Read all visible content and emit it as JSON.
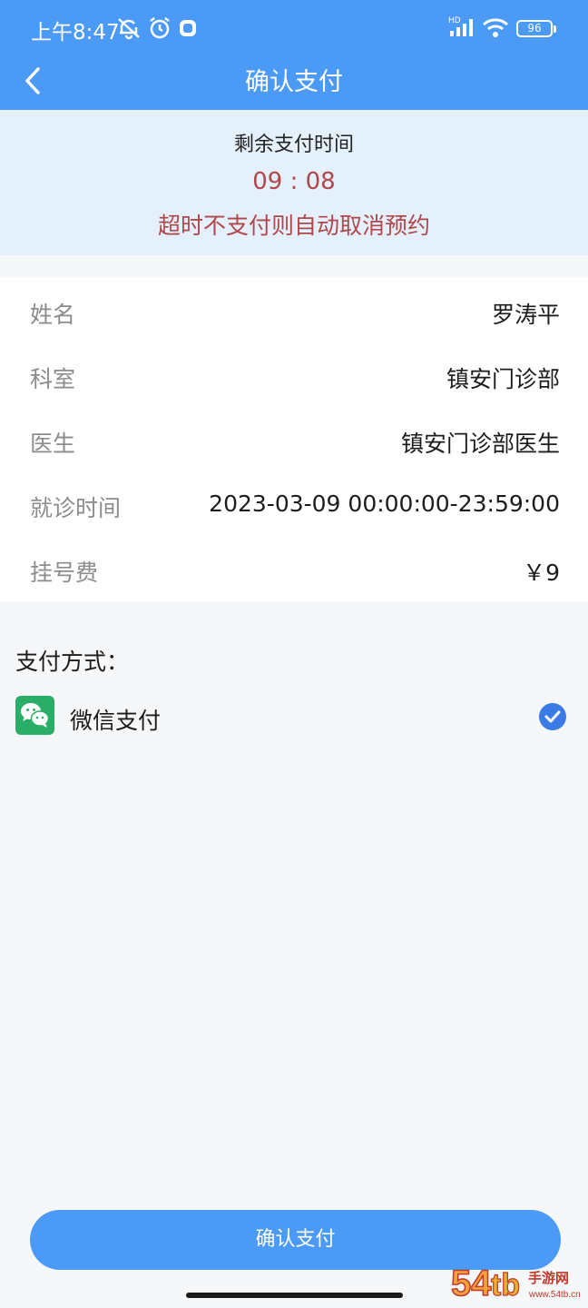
{
  "status_bar": {
    "time": "上午8:47",
    "network_type": "HD",
    "battery": "96",
    "icons": [
      "mute-icon",
      "alarm-icon",
      "app-notification-icon",
      "signal-icon",
      "wifi-icon",
      "battery-icon"
    ]
  },
  "navbar": {
    "title": "确认支付",
    "back_icon": "chevron-left-icon"
  },
  "countdown": {
    "label": "剩余支付时间",
    "value": "09 : 08",
    "warning": "超时不支付则自动取消预约"
  },
  "appointment": {
    "rows": [
      {
        "label": "姓名",
        "value": "罗涛平"
      },
      {
        "label": "科室",
        "value": "镇安门诊部"
      },
      {
        "label": "医生",
        "value": "镇安门诊部医生"
      },
      {
        "label": "就诊时间",
        "value": "2023-03-09 00:00:00-23:59:00"
      },
      {
        "label": "挂号费",
        "value": "￥9"
      }
    ]
  },
  "payment": {
    "title": "支付方式：",
    "method": {
      "name": "微信支付",
      "icon": "wechat-icon",
      "selected": true
    }
  },
  "confirm_button": {
    "label": "确认支付"
  },
  "watermark": {
    "text": "54tb手游网",
    "subtext": "www.54tb.cn"
  },
  "colors": {
    "primary": "#4b9af6",
    "timer_bg": "#e4f0fc",
    "warning_red": "#b0474a",
    "wechat_green": "#2aae67",
    "check_blue": "#3a7be6",
    "page_bg": "#f6f7f9"
  }
}
